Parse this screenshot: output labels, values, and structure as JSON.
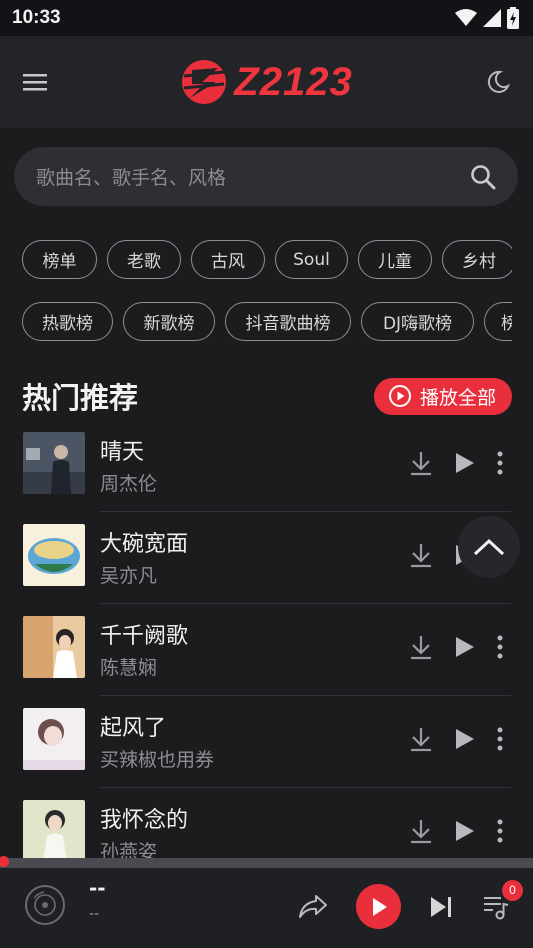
{
  "status_bar": {
    "time": "10:33"
  },
  "header": {
    "menu_icon": "hamburger-menu-icon",
    "logo_text": "Z2123",
    "theme_icon": "moon-icon",
    "accent_color": "#ea2f3c"
  },
  "search": {
    "placeholder": "歌曲名、歌手名、风格",
    "icon": "search-icon"
  },
  "genre_chips": [
    "榜单",
    "老歌",
    "古风",
    "Soul",
    "儿童",
    "乡村"
  ],
  "chart_chips": [
    "热歌榜",
    "新歌榜",
    "抖音歌曲榜",
    "DJ嗨歌榜",
    "榜"
  ],
  "section": {
    "title": "热门推荐",
    "play_all_label": "播放全部"
  },
  "songs": [
    {
      "title": "晴天",
      "artist": "周杰伦"
    },
    {
      "title": "大碗宽面",
      "artist": "吴亦凡"
    },
    {
      "title": "千千阙歌",
      "artist": "陈慧娴"
    },
    {
      "title": "起风了",
      "artist": "买辣椒也用券"
    },
    {
      "title": "我怀念的",
      "artist": "孙燕姿"
    }
  ],
  "player": {
    "title": "--",
    "artist": "--",
    "queue_count": "0",
    "progress": 0
  }
}
